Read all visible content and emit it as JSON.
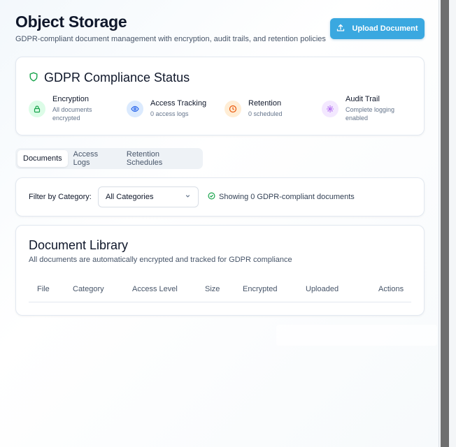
{
  "header": {
    "title": "Object Storage",
    "subtitle": "GDPR-compliant document management with encryption, audit trails, and retention policies",
    "upload_label": "Upload Document"
  },
  "compliance": {
    "title": "GDPR Compliance Status",
    "items": [
      {
        "name": "Encryption",
        "desc_line1": "All documents",
        "desc_line2": "encrypted",
        "icon": "lock-icon",
        "color": "#16a34a",
        "bg": "#dcfce7"
      },
      {
        "name": "Access Tracking",
        "desc_line1": "0 access logs",
        "desc_line2": "",
        "icon": "eye-icon",
        "color": "#2563eb",
        "bg": "#dbeafe"
      },
      {
        "name": "Retention",
        "desc_line1": "0 scheduled",
        "desc_line2": "",
        "icon": "clock-icon",
        "color": "#ea580c",
        "bg": "#ffedd5"
      },
      {
        "name": "Audit Trail",
        "desc_line1": "Complete logging",
        "desc_line2": "enabled",
        "icon": "gear-icon",
        "color": "#9333ea",
        "bg": "#f3e8ff"
      }
    ]
  },
  "tabs": [
    {
      "label": "Documents",
      "active": true
    },
    {
      "label": "Access Logs",
      "active": false
    },
    {
      "label": "Retention Schedules",
      "active": false
    }
  ],
  "filter": {
    "label": "Filter by Category:",
    "selected": "All Categories",
    "info": "Showing 0 GDPR-compliant documents"
  },
  "library": {
    "title": "Document Library",
    "subtitle": "All documents are automatically encrypted and tracked for GDPR compliance",
    "columns": [
      "File",
      "Category",
      "Access Level",
      "Size",
      "Encrypted",
      "Uploaded",
      "Actions"
    ]
  },
  "colors": {
    "accent": "#3aa8e0",
    "success": "#16a34a"
  }
}
